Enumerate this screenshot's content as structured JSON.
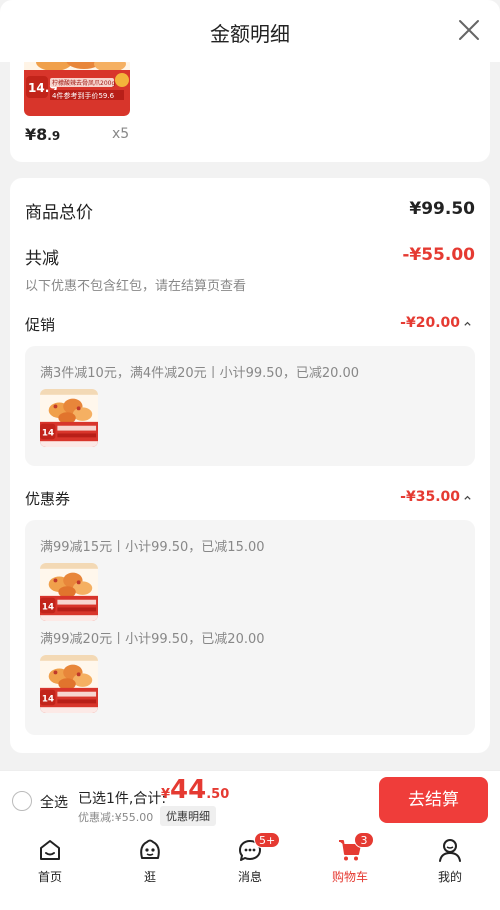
{
  "header": {
    "title": "金额明细"
  },
  "top_item": {
    "price_main": "¥8",
    "price_decimal": ".9",
    "quantity": "x5",
    "thumb_price": "14.9",
    "thumb_badge": "柠檬酸辣去骨凤爪200g",
    "thumb_strip": "4件参考到手价59.6"
  },
  "summary": {
    "goods_total_label": "商品总价",
    "goods_total_value": "¥99.50",
    "total_reduce_label": "共减",
    "total_reduce_value": "-¥55.00",
    "note": "以下优惠不包含红包，请在结算页查看"
  },
  "promotion": {
    "label": "促销",
    "value": "-¥20.00",
    "rule": "满3件减10元，满4件减20元丨小计99.50，已减20.00"
  },
  "coupon": {
    "label": "优惠券",
    "value": "-¥35.00",
    "rules": [
      "满99减15元丨小计99.50，已减15.00",
      "满99减20元丨小计99.50，已减20.00"
    ]
  },
  "checkout": {
    "select_all": "全选",
    "selected_prefix": "已选1件,合计:",
    "total_yen": "¥",
    "total_int": "44",
    "total_dec": ".50",
    "discount": "优惠减:¥55.00",
    "detail_tag": "优惠明细",
    "button": "去结算"
  },
  "tabs": [
    {
      "label": "首页",
      "icon": "home-icon"
    },
    {
      "label": "逛",
      "icon": "smiley-face-icon"
    },
    {
      "label": "消息",
      "icon": "chat-bubble-icon",
      "badge": "5+"
    },
    {
      "label": "购物车",
      "icon": "shopping-cart-icon",
      "badge": "3"
    },
    {
      "label": "我的",
      "icon": "user-icon"
    }
  ],
  "colors": {
    "accent": "#e53a32",
    "checkout": "#ef3d3a",
    "background": "#f2f2f2"
  }
}
